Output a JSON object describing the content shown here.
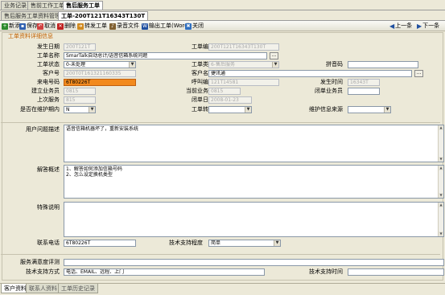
{
  "top_tabs": [
    "业务记录",
    "售前工作工单",
    "售后服务工单"
  ],
  "sub_tabs": [
    "售后服务工单资料管理",
    "工单-200T121T16343T130T"
  ],
  "toolbar": {
    "new": "新添",
    "save": "保存",
    "cancel": "取消",
    "delete": "删除",
    "dispatch": "转发工单",
    "record": "录音文件",
    "export": "输出工单(Word)",
    "close": "关闭",
    "prev": "上一条",
    "next": "下一条"
  },
  "section_title": "工单资料详细信息",
  "form": {
    "create_date": {
      "label": "发生日期",
      "value": "200T121T"
    },
    "ticket_no": {
      "label": "工单编号",
      "value": "200T121T16343T130T"
    },
    "ticket_name": {
      "label": "工单名称",
      "value": "SmarTalk自动总计/语音信箱系统问题"
    },
    "ticket_status": {
      "label": "工单状态",
      "value": "0-未处理"
    },
    "ticket_type": {
      "label": "工单类型",
      "value": "6-售后服务"
    },
    "pinyin": {
      "label": "拼音码",
      "value": ""
    },
    "customer_no": {
      "label": "客户号",
      "value": "200T0T161321160335"
    },
    "customer_name": {
      "label": "客户名称",
      "value": "捷讯通"
    },
    "caller": {
      "label": "来电号码",
      "value": "6T80226T"
    },
    "call_no": {
      "label": "呼叫编号",
      "value": "121T14581"
    },
    "time": {
      "label": "发生时间",
      "value": "16343T"
    },
    "creator": {
      "label": "建立业务员",
      "value": "0815"
    },
    "current_staff": {
      "label": "当前业务员",
      "value": "0815"
    },
    "closing_staff": {
      "label": "闭单业务员",
      "value": ""
    },
    "last_service": {
      "label": "上次服务",
      "value": "815"
    },
    "closing_date": {
      "label": "闭单日期",
      "value": "2008-01-23"
    },
    "in_warranty": {
      "label": "是否在维护期内",
      "value": "N"
    },
    "transfer": {
      "label": "工单转至",
      "value": ""
    },
    "maint_source": {
      "label": "维护信息来源",
      "value": ""
    },
    "problem_desc": {
      "label": "用户问题描述",
      "value": "语音信箱机器坏了，重新安装系统"
    },
    "answer": {
      "label": "解答概述",
      "value": "1、解答如何添加信箱号码\n2、怎么设定换机类型"
    },
    "special": {
      "label": "特殊说明",
      "value": ""
    },
    "contact_phone": {
      "label": "联系电话",
      "value": "6T80226T"
    },
    "support_level": {
      "label": "技术支持程度",
      "value": "简单"
    },
    "satisfaction": {
      "label": "服务满意度评测",
      "value": ""
    },
    "support_method": {
      "label": "技术支持方式",
      "value": "电话、EMAIL、远程、上门"
    },
    "support_time": {
      "label": "技术支持时间",
      "value": ""
    }
  },
  "bottom_tabs": [
    "客户资料",
    "联系人资料",
    "工单历史记录"
  ],
  "colors": {
    "accent": "#f28a1e",
    "section": "#c06000"
  }
}
